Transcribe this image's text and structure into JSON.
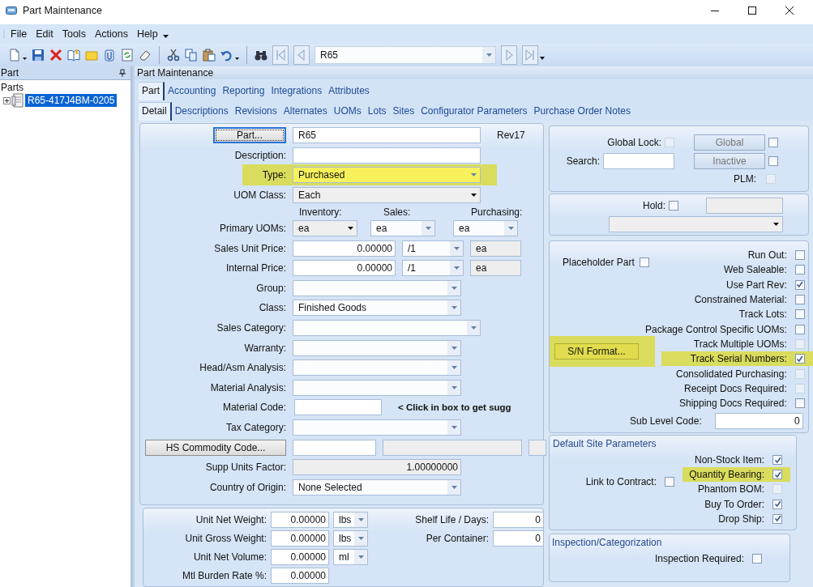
{
  "window": {
    "title": "Part Maintenance"
  },
  "menu": [
    "File",
    "Edit",
    "Tools",
    "Actions",
    "Help"
  ],
  "toolbar": {
    "record": "R65"
  },
  "tree_pane": {
    "title": "Part",
    "root": "Parts",
    "items": [
      {
        "label": "R65-417J4BM-0205",
        "selected": true
      }
    ]
  },
  "content": {
    "title": "Part Maintenance"
  },
  "tabs": [
    {
      "label": "Part",
      "selected": true
    },
    {
      "label": "Accounting",
      "selected": false
    },
    {
      "label": "Reporting",
      "selected": false
    },
    {
      "label": "Integrations",
      "selected": false
    },
    {
      "label": "Attributes",
      "selected": false
    }
  ],
  "subtabs": [
    {
      "label": "Detail",
      "selected": true
    },
    {
      "label": "Descriptions",
      "selected": false
    },
    {
      "label": "Revisions",
      "selected": false
    },
    {
      "label": "Alternates",
      "selected": false
    },
    {
      "label": "UOMs",
      "selected": false
    },
    {
      "label": "Lots",
      "selected": false
    },
    {
      "label": "Sites",
      "selected": false
    },
    {
      "label": "Configurator Parameters",
      "selected": false
    },
    {
      "label": "Purchase Order Notes",
      "selected": false
    }
  ],
  "form": [
    {
      "kind": "part",
      "button": "Part...",
      "value": "R65",
      "note": "Rev17"
    },
    {
      "kind": "text",
      "label": "Description:"
    },
    {
      "kind": "long-combo",
      "label": "Type:",
      "value": "Purchased",
      "highlighted": true
    },
    {
      "kind": "long-dropdown",
      "label": "UOM Class:",
      "value": "Each",
      "highlighted": false
    },
    {
      "kind": "uoms",
      "label": "Primary UOMs:",
      "columns": [
        {
          "header": "Inventory:",
          "value": "ea",
          "kind": "dropdown"
        },
        {
          "header": "Sales:",
          "value": "ea",
          "kind": "combo"
        },
        {
          "header": "Purchasing:",
          "value": "ea",
          "kind": "combo"
        }
      ]
    },
    {
      "kind": "price",
      "label": "Sales Unit Price:",
      "value": "0.00000",
      "per": "/1",
      "unit": "ea"
    },
    {
      "kind": "price",
      "label": "Internal Price:",
      "value": "0.00000",
      "per": "/1",
      "unit": "ea"
    },
    {
      "kind": "combo",
      "label": "Group:",
      "highlighted": false
    },
    {
      "kind": "combo",
      "label": "Class:",
      "value": "Finished Goods",
      "highlighted": false
    },
    {
      "kind": "long-combo",
      "label": "Sales Category:",
      "highlighted": false
    },
    {
      "kind": "combo",
      "label": "Warranty:",
      "highlighted": false
    },
    {
      "kind": "combo",
      "label": "Head/Asm Analysis:",
      "highlighted": false
    },
    {
      "kind": "combo",
      "label": "Material Analysis:",
      "highlighted": false
    },
    {
      "kind": "code",
      "label": "Material Code:",
      "hint": "< Click in box to get sugg"
    },
    {
      "kind": "combo",
      "label": "Tax Category:",
      "highlighted": false
    },
    {
      "kind": "lookup",
      "button": "HS Commodity Code..."
    },
    {
      "kind": "number",
      "label": "Supp Units Factor:",
      "value": "1.00000000"
    },
    {
      "kind": "combo",
      "label": "Country of Origin:",
      "value": "None Selected",
      "highlighted": false
    }
  ],
  "measures": [
    {
      "label": "Unit Net Weight:",
      "value": "0.00000",
      "unit": "lbs"
    },
    {
      "label": "Unit Gross Weight:",
      "value": "0.00000",
      "unit": "lbs"
    },
    {
      "label": "Unit Net Volume:",
      "value": "0.00000",
      "unit": "ml"
    },
    {
      "label": "Mtl Burden Rate %:",
      "value": "0.00000"
    }
  ],
  "shelf": [
    {
      "label": "Shelf Life / Days:",
      "value": "0"
    },
    {
      "label": "Per Container:",
      "value": "0"
    }
  ],
  "global": {
    "lock": {
      "label": "Global Lock:",
      "checked": false,
      "disabled": true
    },
    "search_label": "Search:",
    "buttons": [
      {
        "label": "Global",
        "checked": false
      },
      {
        "label": "Inactive",
        "checked": false
      }
    ],
    "plm": {
      "label": "PLM:",
      "checked": false,
      "disabled": true
    }
  },
  "hold": {
    "label": "Hold:",
    "checked": false
  },
  "attributes": {
    "placeholder": {
      "label": "Placeholder Part",
      "checked": false
    },
    "sn_button": {
      "label": "S/N Format...",
      "highlighted": true
    },
    "flags": [
      {
        "label": "Run Out:",
        "checked": false,
        "disabled": false,
        "highlighted": false
      },
      {
        "label": "Web Saleable:",
        "checked": false,
        "disabled": false,
        "highlighted": false
      },
      {
        "label": "Use Part Rev:",
        "checked": true,
        "disabled": false,
        "highlighted": false
      },
      {
        "label": "Constrained Material:",
        "checked": false,
        "disabled": false,
        "highlighted": false
      },
      {
        "label": "Track Lots:",
        "checked": false,
        "disabled": false,
        "highlighted": false
      },
      {
        "label": "Package Control Specific UOMs:",
        "checked": false,
        "disabled": false,
        "highlighted": false
      },
      {
        "label": "Track Multiple UOMs:",
        "checked": false,
        "disabled": true,
        "highlighted": false
      },
      {
        "label": "Track Serial Numbers:",
        "checked": true,
        "disabled": false,
        "highlighted": true
      },
      {
        "label": "Consolidated Purchasing:",
        "checked": false,
        "disabled": true,
        "highlighted": false
      },
      {
        "label": "Receipt Docs Required:",
        "checked": false,
        "disabled": true,
        "highlighted": false
      },
      {
        "label": "Shipping Docs Required:",
        "checked": false,
        "disabled": false,
        "highlighted": false
      }
    ],
    "sub_level": {
      "label": "Sub Level Code:",
      "value": "0"
    }
  },
  "site": {
    "title": "Default Site Parameters",
    "link": {
      "label": "Link to Contract:",
      "checked": false
    },
    "flags": [
      {
        "label": "Non-Stock Item:",
        "checked": true,
        "disabled": false,
        "highlighted": false
      },
      {
        "label": "Quantity Bearing:",
        "checked": true,
        "disabled": false,
        "highlighted": true
      },
      {
        "label": "Phantom BOM:",
        "checked": false,
        "disabled": true,
        "highlighted": false
      },
      {
        "label": "Buy To Order:",
        "checked": true,
        "disabled": false,
        "highlighted": false
      },
      {
        "label": "Drop Ship:",
        "checked": true,
        "disabled": false,
        "highlighted": false
      }
    ]
  },
  "inspection": {
    "title": "Inspection/Categorization",
    "required": {
      "label": "Inspection Required:",
      "checked": false
    }
  }
}
